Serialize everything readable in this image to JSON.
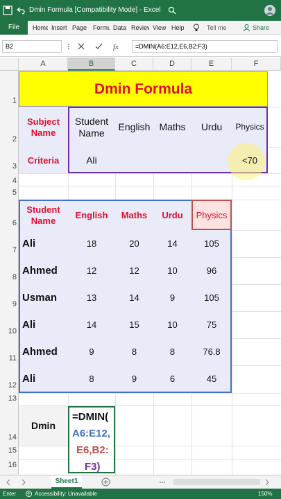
{
  "title": {
    "filename": "Dmin Formula [Compatibility Mode] - Excel",
    "share": "Share",
    "tellme": "Tell me"
  },
  "ribbon": {
    "file": "File",
    "tabs": [
      "Home",
      "Insert",
      "Page Layout",
      "Formulas",
      "Data",
      "Review",
      "View",
      "Help"
    ]
  },
  "formula_bar": {
    "name_box": "B2",
    "formula": "=DMIN(A6:E12,E6,B2:F3)"
  },
  "columns": [
    "A",
    "B",
    "C",
    "D",
    "E",
    "F"
  ],
  "rows": [
    "1",
    "2",
    "3",
    "4",
    "5",
    "6",
    "7",
    "8",
    "9",
    "10",
    "11",
    "12",
    "13",
    "14",
    "15",
    "16"
  ],
  "sheet": {
    "title": "Dmin Formula",
    "criteria_headers": [
      "Subject Name",
      "Student Name",
      "English",
      "Maths",
      "Urdu",
      "Physics"
    ],
    "criteria_row": {
      "label": "Criteria",
      "student": "Ali",
      "physics": "<70"
    },
    "data_headers": [
      "Student Name",
      "English",
      "Maths",
      "Urdu",
      "Physics"
    ],
    "data_rows": [
      {
        "name": "Ali",
        "english": "18",
        "maths": "20",
        "urdu": "14",
        "physics": "105"
      },
      {
        "name": "Ahmed",
        "english": "12",
        "maths": "12",
        "urdu": "10",
        "physics": "96"
      },
      {
        "name": "Usman",
        "english": "13",
        "maths": "14",
        "urdu": "9",
        "physics": "105"
      },
      {
        "name": "Ali",
        "english": "14",
        "maths": "15",
        "urdu": "10",
        "physics": "75"
      },
      {
        "name": "Ahmed",
        "english": "9",
        "maths": "8",
        "urdu": "8",
        "physics": "76.8"
      },
      {
        "name": "Ali",
        "english": "8",
        "maths": "9",
        "urdu": "6",
        "physics": "45"
      }
    ],
    "result_label": "Dmin",
    "formula_edit": {
      "l1": "=DMIN(",
      "l2": "A6:E12,",
      "l3": "E6,B2:",
      "l4": "F3)"
    }
  },
  "sheet_tab": "Sheet1",
  "status": {
    "mode": "Enter",
    "accessibility": "Accessibility: Unavailable",
    "zoom": "150%"
  },
  "colors": {
    "excel_green": "#217346",
    "title_fill": "#ffff00",
    "title_text": "#e0102e",
    "table_fill": "#e9ecf8",
    "range_blue": "#4472c4",
    "range_red": "#c0504d",
    "range_purple": "#7030a0"
  }
}
